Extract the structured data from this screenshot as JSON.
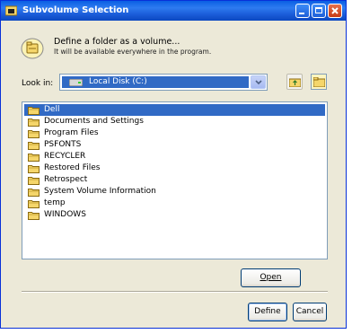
{
  "window": {
    "title": "Subvolume Selection",
    "controls": {
      "minimize": "_",
      "maximize": "□",
      "close": "X"
    }
  },
  "info": {
    "icon": "volume-icon",
    "line1": "Define a folder as a volume...",
    "line2": "It will be available everywhere in the program."
  },
  "lookin": {
    "label": "Look in:",
    "value": "Local Disk (C:)",
    "drive_icon": "hard-drive-icon",
    "up_icon": "up-folder-icon",
    "new_folder_icon": "new-folder-icon"
  },
  "files": [
    {
      "name": "Dell",
      "selected": true
    },
    {
      "name": "Documents and Settings",
      "selected": false
    },
    {
      "name": "Program Files",
      "selected": false
    },
    {
      "name": "PSFONTS",
      "selected": false
    },
    {
      "name": "RECYCLER",
      "selected": false
    },
    {
      "name": "Restored Files",
      "selected": false
    },
    {
      "name": "Retrospect",
      "selected": false
    },
    {
      "name": "System Volume Information",
      "selected": false
    },
    {
      "name": "temp",
      "selected": false
    },
    {
      "name": "WINDOWS",
      "selected": false
    }
  ],
  "buttons": {
    "open": "Open",
    "define": "Define",
    "cancel": "Cancel"
  },
  "colors": {
    "titlebar": "#0A5FE3",
    "selection": "#316AC5",
    "dialog_bg": "#ECE9D8",
    "folder": "#F5D66B"
  }
}
